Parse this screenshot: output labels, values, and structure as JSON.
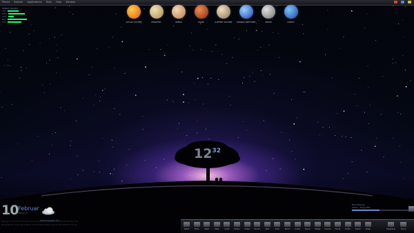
{
  "menubar": {
    "items": [
      "Places",
      "System",
      "Applications",
      "Tools",
      "Help",
      "Window"
    ],
    "tray": [
      "volume",
      "network",
      "battery"
    ],
    "tray_colors": [
      "#d94a2a",
      "#4a8ad9",
      "#d9c22a"
    ]
  },
  "planets": [
    {
      "name": "Sun",
      "label": "SOLAR SYSTEM",
      "color_a": "#ffcc44",
      "color_b": "#e05a10"
    },
    {
      "name": "Mercury",
      "label": "MERCURY",
      "color_a": "#f2e0b0",
      "color_b": "#a88a50"
    },
    {
      "name": "Venus",
      "label": "VENUS",
      "color_a": "#f4d8b0",
      "color_b": "#b87850"
    },
    {
      "name": "Mars",
      "label": "MARS",
      "color_a": "#f08a50",
      "color_b": "#8a2a10"
    },
    {
      "name": "Saturn",
      "label": "JUPITER SATURN",
      "color_a": "#f0e0c0",
      "color_b": "#8a7050"
    },
    {
      "name": "Neptune",
      "label": "URANUS NEPTUNE",
      "color_a": "#9ad0ff",
      "color_b": "#2040b0"
    },
    {
      "name": "Moon",
      "label": "MOON",
      "color_a": "#e0e0e0",
      "color_b": "#707070"
    },
    {
      "name": "Earth",
      "label": "EARTH",
      "color_a": "#7ac0ff",
      "color_b": "#1a4aa0"
    }
  ],
  "sysmon": {
    "title": "System Monitor",
    "rows": [
      {
        "label": "CPU",
        "level": 0.4
      },
      {
        "label": "MEM",
        "level": 0.6
      },
      {
        "label": "SWP",
        "level": 0.2
      },
      {
        "label": "NET",
        "level": 0.7
      },
      {
        "label": "DSK",
        "level": 0.5
      }
    ]
  },
  "clock": {
    "hour": "12",
    "minute": "32"
  },
  "date": {
    "day": "10",
    "month": "Februar",
    "weekday": "Mittwoch"
  },
  "weather": {
    "condition": "cloud-icon",
    "text": "leicht bewölkt -2°C"
  },
  "calendar": {
    "line1": "Februar 1 2 3 4 5 6 7 8 9 10 11 12 13 14 15 16 17 18 19 20 21 22 23 24 25 26 27 28",
    "line2": "Mo Di Mi Do Fr Sa So Mo Di Mi Do Fr Sa So Mo Di Mi Do Fr Sa So Mo Di Mi Do Fr Sa So"
  },
  "dock": {
    "items": [
      "Start",
      "Files",
      "Web",
      "Mail",
      "Chat",
      "Music",
      "Video",
      "Photo",
      "Text",
      "Calc",
      "Term",
      "Code",
      "Draw",
      "Maps",
      "Game",
      "Tools",
      "Prefs",
      "Trash",
      "Help"
    ],
    "right_items": [
      "Desktop",
      "Shut"
    ]
  },
  "rwidget": {
    "title": "Now Playing",
    "track": "Artist – Song Title",
    "progress": 0.45
  }
}
